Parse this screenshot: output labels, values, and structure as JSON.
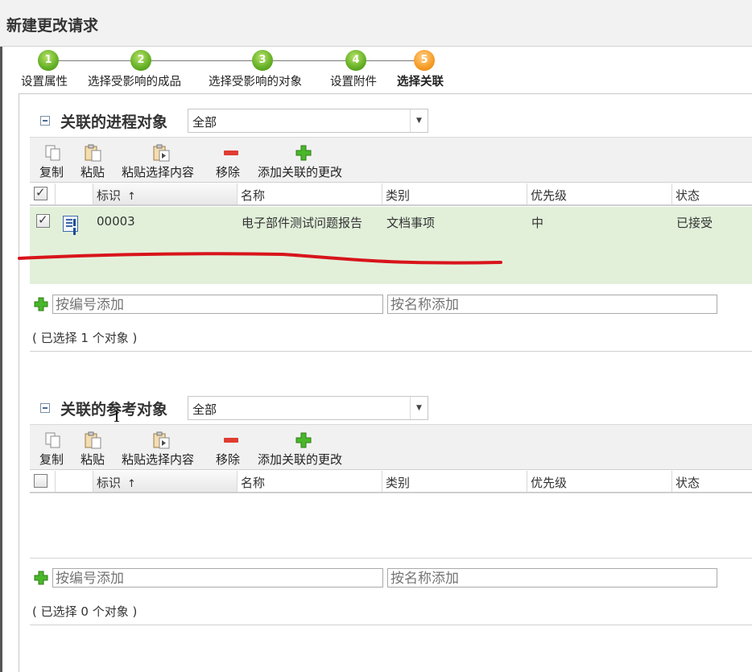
{
  "window": {
    "title": "新建更改请求"
  },
  "wizard": {
    "steps": [
      {
        "number": "1",
        "label": "设置属性",
        "state": "done"
      },
      {
        "number": "2",
        "label": "选择受影响的成品",
        "state": "done"
      },
      {
        "number": "3",
        "label": "选择受影响的对象",
        "state": "done"
      },
      {
        "number": "4",
        "label": "设置附件",
        "state": "done"
      },
      {
        "number": "5",
        "label": "选择关联",
        "state": "current"
      }
    ],
    "colors": {
      "done": "#6bb42a",
      "current": "#f7a02b"
    }
  },
  "toolbar_labels": {
    "copy": "复制",
    "paste": "粘贴",
    "paste_selection": "粘贴选择内容",
    "remove": "移除",
    "add_related_change": "添加关联的更改"
  },
  "columns": {
    "id": "标识",
    "sort_indicator": "↑",
    "name": "名称",
    "category": "类别",
    "priority": "优先级",
    "status": "状态"
  },
  "process_section": {
    "title": "关联的进程对象",
    "filter": "全部",
    "header_checked": true,
    "rows": [
      {
        "checked": true,
        "icon": "document-icon",
        "id": "00003",
        "name": "电子部件测试问题报告",
        "category": "文档事项",
        "priority": "中",
        "status": "已接受"
      }
    ],
    "add_by_number_placeholder": "按编号添加",
    "add_by_name_placeholder": "按名称添加",
    "selection_count": "( 已选择 1 个对象 )"
  },
  "reference_section": {
    "title": "关联的参考对象",
    "filter": "全部",
    "header_checked": false,
    "rows": [],
    "add_by_number_placeholder": "按编号添加",
    "add_by_name_placeholder": "按名称添加",
    "selection_count": "( 已选择 0 个对象 )"
  },
  "colors": {
    "selected_row_bg": "#e2f0da",
    "remove_icon": "#e03c31",
    "add_icon": "#3aa51c",
    "annotation_stroke": "#d8141b"
  }
}
